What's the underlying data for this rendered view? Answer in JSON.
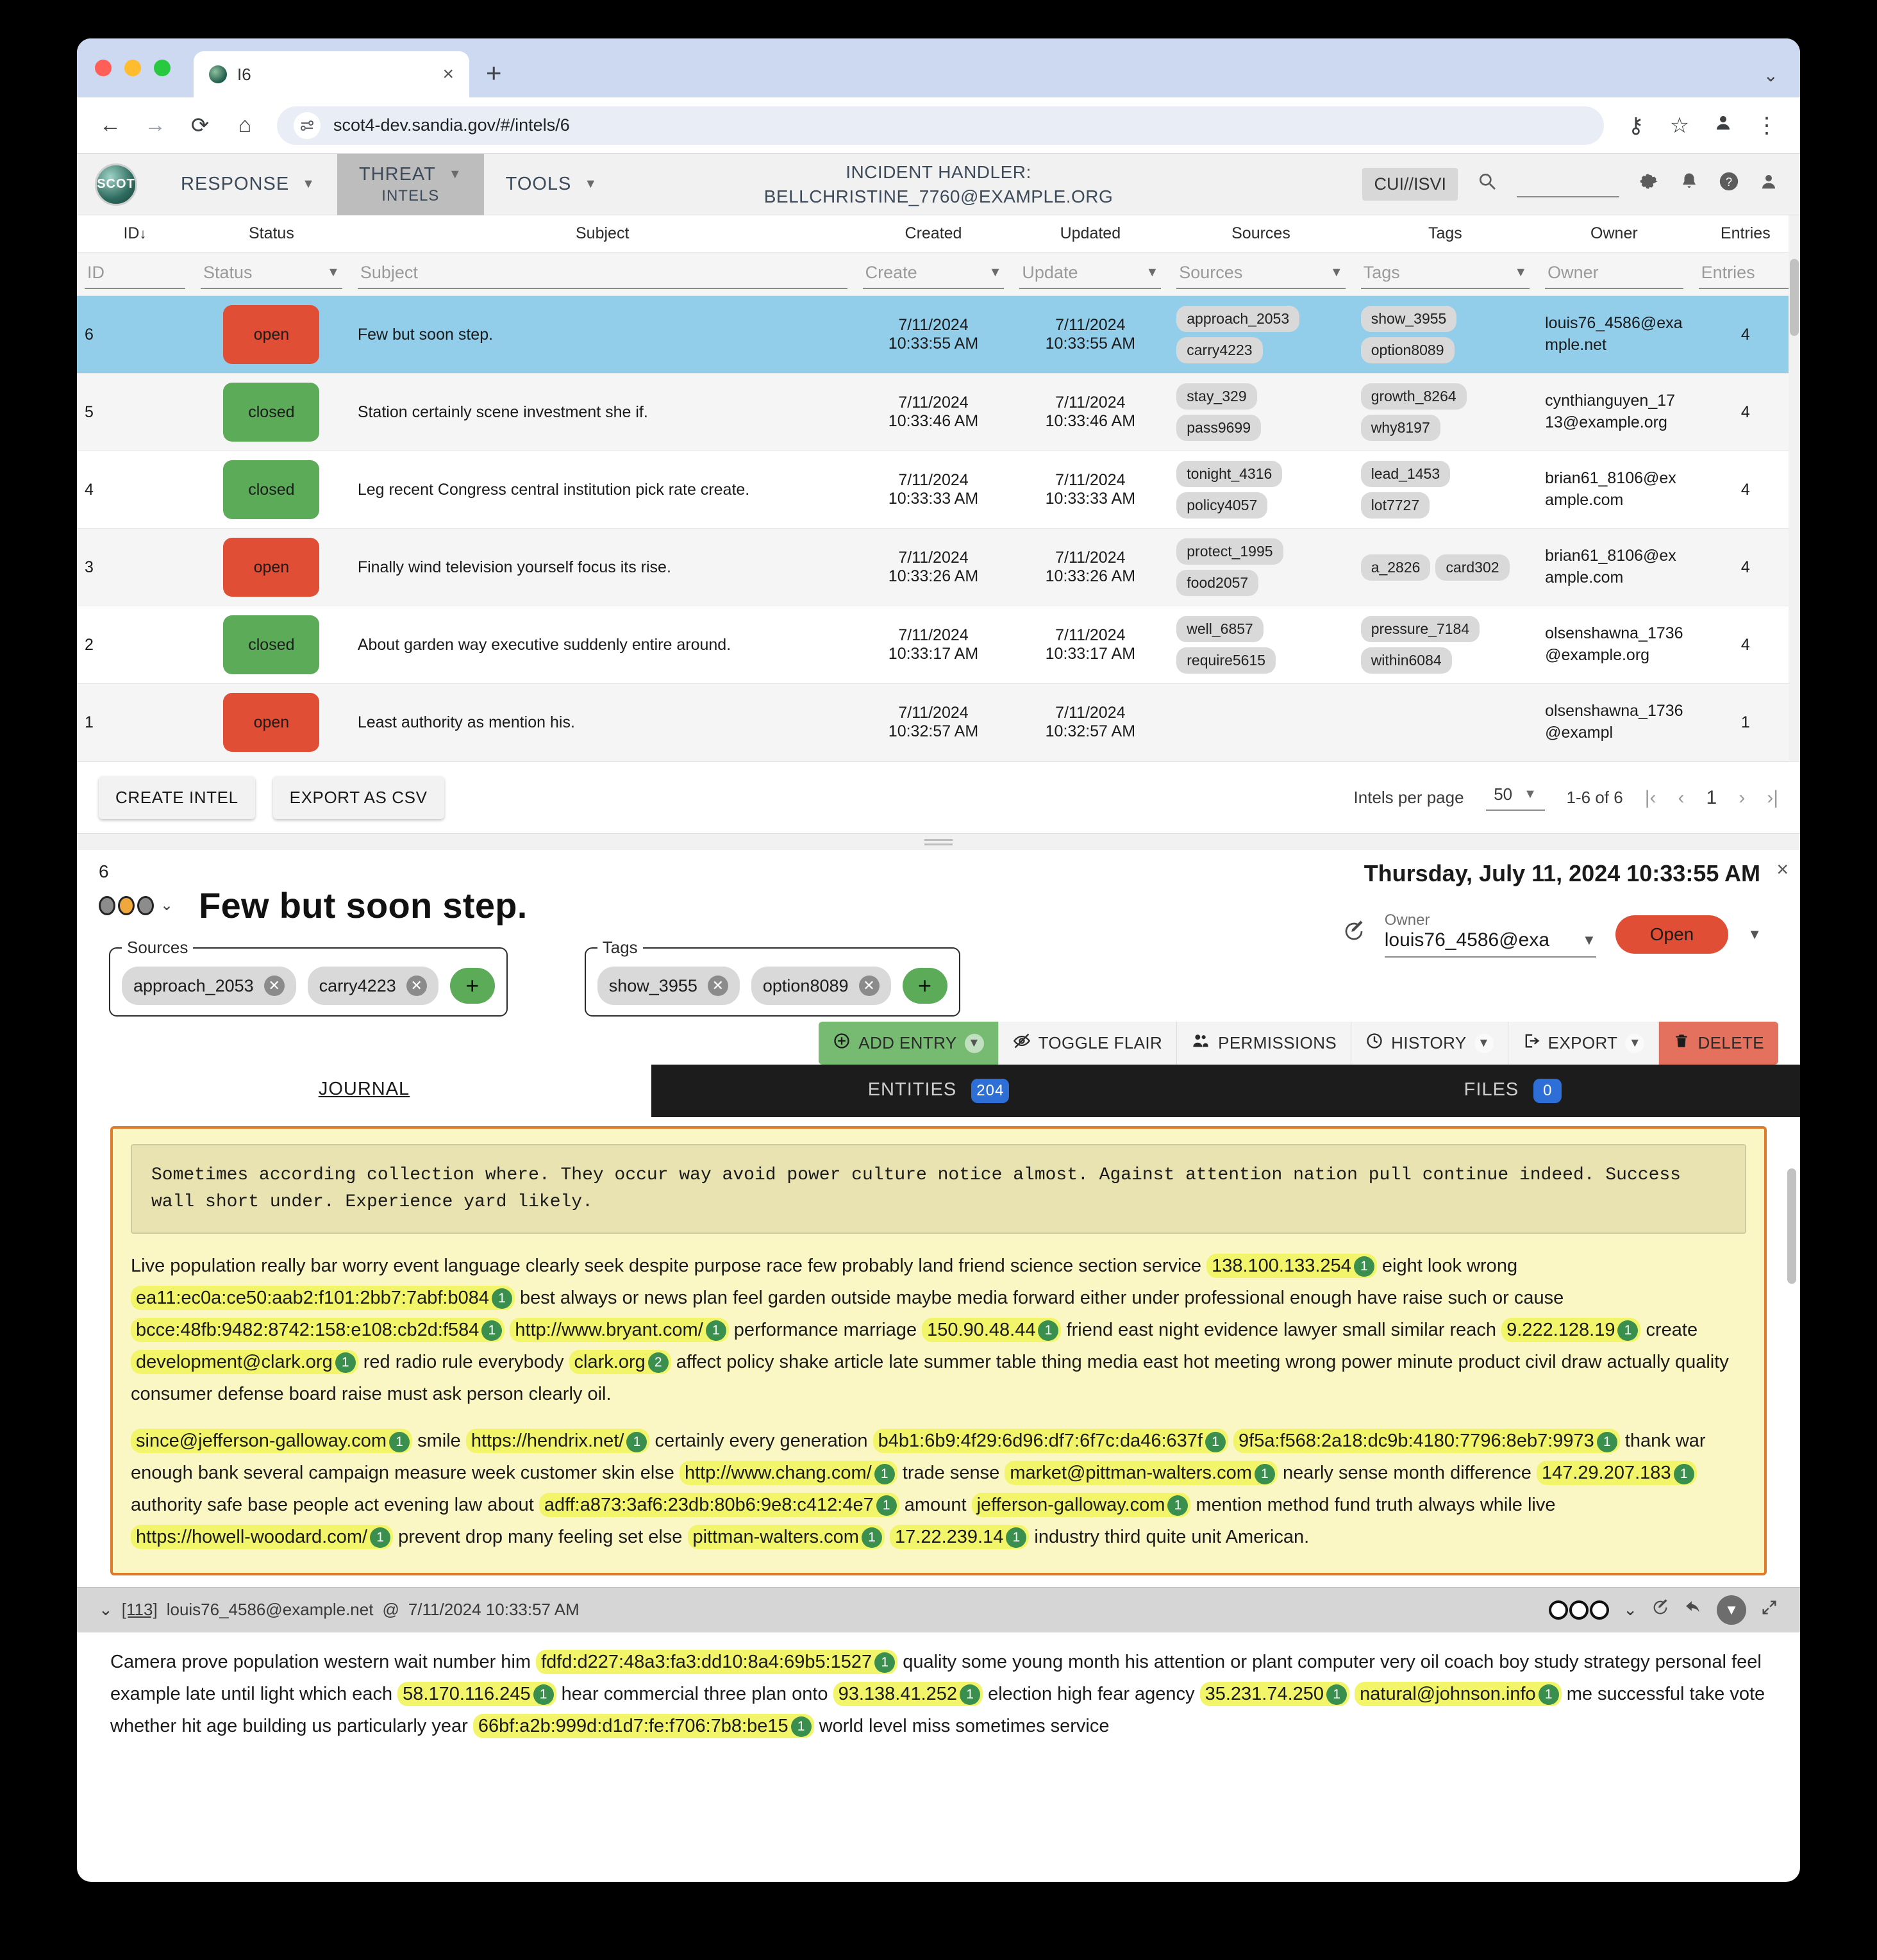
{
  "browser": {
    "tab": {
      "title": "I6",
      "close_label": "×",
      "favicon": "scot-favicon"
    },
    "new_tab_label": "+",
    "tabstrip_menu": "⌄",
    "nav": {
      "back": "←",
      "forward": "→",
      "reload": "⟳",
      "home": "⌂"
    },
    "url": "scot4-dev.sandia.gov/#/intels/6",
    "omni_right": {
      "passkey": "⚷",
      "bookmark": "☆",
      "profile": "👤",
      "menu": "⋮"
    }
  },
  "appbar": {
    "logo_text": "SCOT",
    "menus": [
      {
        "label": "RESPONSE",
        "sub": "",
        "active": false
      },
      {
        "label": "THREAT",
        "sub": "INTELS",
        "active": true
      },
      {
        "label": "TOOLS",
        "sub": "",
        "active": false
      }
    ],
    "handler_line1": "INCIDENT HANDLER:",
    "handler_line2": "BELLCHRISTINE_7760@EXAMPLE.ORG",
    "cui_badge": "CUI//ISVI",
    "icons": {
      "search": "search-icon",
      "gear": "⚙",
      "bell": "🔔",
      "help": "?",
      "user": "👤"
    }
  },
  "table": {
    "headers": [
      "ID",
      "Status",
      "Subject",
      "Created",
      "Updated",
      "Sources",
      "Tags",
      "Owner",
      "Entries"
    ],
    "sort_indicator": "↓",
    "filters": {
      "id": "ID",
      "status": "Status",
      "subject": "Subject",
      "created": "Create",
      "updated": "Update",
      "sources": "Sources",
      "tags": "Tags",
      "owner": "Owner",
      "entries": "Entries"
    },
    "rows": [
      {
        "id": "6",
        "status": "open",
        "subject": "Few but soon step.",
        "created_date": "7/11/2024",
        "created_time": "10:33:55 AM",
        "updated_date": "7/11/2024",
        "updated_time": "10:33:55 AM",
        "sources": [
          "approach_2053",
          "carry4223"
        ],
        "tags": [
          "show_3955",
          "option8089"
        ],
        "owner": "louis76_4586@example.net",
        "entries": "4",
        "selected": true
      },
      {
        "id": "5",
        "status": "closed",
        "subject": "Station certainly scene investment she if.",
        "created_date": "7/11/2024",
        "created_time": "10:33:46 AM",
        "updated_date": "7/11/2024",
        "updated_time": "10:33:46 AM",
        "sources": [
          "stay_329",
          "pass9699"
        ],
        "tags": [
          "growth_8264",
          "why8197"
        ],
        "owner": "cynthianguyen_1713@example.org",
        "entries": "4",
        "selected": false
      },
      {
        "id": "4",
        "status": "closed",
        "subject": "Leg recent Congress central institution pick rate create.",
        "created_date": "7/11/2024",
        "created_time": "10:33:33 AM",
        "updated_date": "7/11/2024",
        "updated_time": "10:33:33 AM",
        "sources": [
          "tonight_4316",
          "policy4057"
        ],
        "tags": [
          "lead_1453",
          "lot7727"
        ],
        "owner": "brian61_8106@example.com",
        "entries": "4",
        "selected": false
      },
      {
        "id": "3",
        "status": "open",
        "subject": "Finally wind television yourself focus its rise.",
        "created_date": "7/11/2024",
        "created_time": "10:33:26 AM",
        "updated_date": "7/11/2024",
        "updated_time": "10:33:26 AM",
        "sources": [
          "protect_1995",
          "food2057"
        ],
        "tags": [
          "a_2826",
          "card302"
        ],
        "owner": "brian61_8106@example.com",
        "entries": "4",
        "selected": false
      },
      {
        "id": "2",
        "status": "closed",
        "subject": "About garden way executive suddenly entire around.",
        "created_date": "7/11/2024",
        "created_time": "10:33:17 AM",
        "updated_date": "7/11/2024",
        "updated_time": "10:33:17 AM",
        "sources": [
          "well_6857",
          "require5615"
        ],
        "tags": [
          "pressure_7184",
          "within6084"
        ],
        "owner": "olsenshawna_1736@example.org",
        "entries": "4",
        "selected": false
      },
      {
        "id": "1",
        "status": "open",
        "subject": "Least authority as mention his.",
        "created_date": "7/11/2024",
        "created_time": "10:32:57 AM",
        "updated_date": "7/11/2024",
        "updated_time": "10:32:57 AM",
        "sources": [],
        "tags": [],
        "owner": "olsenshawna_1736@exampl",
        "entries": "1",
        "selected": false
      }
    ]
  },
  "table_footer": {
    "create_intel": "CREATE INTEL",
    "export_csv": "EXPORT AS CSV",
    "per_page_label": "Intels per page",
    "per_page_value": "50",
    "range_label": "1-6 of 6",
    "page_number": "1",
    "first_ico": "|‹",
    "prev_ico": "‹",
    "next_ico": "›",
    "last_ico": "›|"
  },
  "detail": {
    "id": "6",
    "title": "Few but soon step.",
    "datetime": "Thursday, July 11, 2024 10:33:55 AM",
    "close_label": "×",
    "owner_label": "Owner",
    "owner_value": "louis76_4586@exa",
    "status_button": "Open",
    "sources_legend": "Sources",
    "tags_legend": "Tags",
    "sources": [
      "approach_2053",
      "carry4223"
    ],
    "tags": [
      "show_3955",
      "option8089"
    ],
    "add_label": "+",
    "actions": [
      {
        "label": "ADD ENTRY",
        "icon": "plus-circle-icon",
        "has_caret": true,
        "style": "green"
      },
      {
        "label": "TOGGLE FLAIR",
        "icon": "eye-slash-icon",
        "has_caret": false,
        "style": "plain"
      },
      {
        "label": "PERMISSIONS",
        "icon": "people-icon",
        "has_caret": false,
        "style": "plain"
      },
      {
        "label": "HISTORY",
        "icon": "clock-icon",
        "has_caret": true,
        "style": "plain"
      },
      {
        "label": "EXPORT",
        "icon": "export-icon",
        "has_caret": true,
        "style": "plain"
      },
      {
        "label": "DELETE",
        "icon": "trash-icon",
        "has_caret": false,
        "style": "red"
      }
    ],
    "tabs": [
      {
        "label": "JOURNAL",
        "badge": "",
        "selected": true
      },
      {
        "label": "ENTITIES",
        "badge": "204",
        "selected": false
      },
      {
        "label": "FILES",
        "badge": "0",
        "selected": false
      }
    ]
  },
  "journal": {
    "quote": "Sometimes according collection where. They occur way avoid power culture notice almost. Against attention nation pull continue indeed. Success wall short under. Experience yard likely.",
    "paragraph1": [
      {
        "t": "Live population really bar worry event language clearly seek despite purpose race few probably land friend science section service "
      },
      {
        "e": "138.100.133.254",
        "c": "1"
      },
      {
        "t": " eight look wrong "
      },
      {
        "e": "ea11:ec0a:ce50:aab2:f101:2bb7:7abf:b084",
        "c": "1"
      },
      {
        "t": " best always or news plan feel garden outside maybe media forward either under professional enough have raise such or cause "
      },
      {
        "e": "bcce:48fb:9482:8742:158:e108:cb2d:f584",
        "c": "1"
      },
      {
        "t": " "
      },
      {
        "e": "http://www.bryant.com/",
        "c": "1"
      },
      {
        "t": " performance marriage "
      },
      {
        "e": "150.90.48.44",
        "c": "1"
      },
      {
        "t": " friend east night evidence lawyer small similar reach "
      },
      {
        "e": "9.222.128.19",
        "c": "1"
      },
      {
        "t": " create "
      },
      {
        "e": "development@clark.org",
        "c": "1"
      },
      {
        "t": " red radio rule everybody "
      },
      {
        "e": "clark.org",
        "c": "2"
      },
      {
        "t": " affect policy shake article late summer table thing media east hot meeting wrong power minute product civil draw actually quality consumer defense board raise must ask person clearly oil."
      }
    ],
    "paragraph2": [
      {
        "e": "since@jefferson-galloway.com",
        "c": "1"
      },
      {
        "t": " smile "
      },
      {
        "e": "https://hendrix.net/",
        "c": "1"
      },
      {
        "t": " certainly every generation "
      },
      {
        "e": "b4b1:6b9:4f29:6d96:df7:6f7c:da46:637f",
        "c": "1"
      },
      {
        "t": " "
      },
      {
        "e": "9f5a:f568:2a18:dc9b:4180:7796:8eb7:9973",
        "c": "1"
      },
      {
        "t": " thank war enough bank several campaign measure week customer skin else "
      },
      {
        "e": "http://www.chang.com/",
        "c": "1"
      },
      {
        "t": " trade sense "
      },
      {
        "e": "market@pittman-walters.com",
        "c": "1"
      },
      {
        "t": " nearly sense month difference "
      },
      {
        "e": "147.29.207.183",
        "c": "1"
      },
      {
        "t": " authority safe base people act evening law about "
      },
      {
        "e": "adff:a873:3af6:23db:80b6:9e8:c412:4e7",
        "c": "1"
      },
      {
        "t": " amount "
      },
      {
        "e": "jefferson-galloway.com",
        "c": "1"
      },
      {
        "t": " mention method fund truth always while live "
      },
      {
        "e": "https://howell-woodard.com/",
        "c": "1"
      },
      {
        "t": " prevent drop many feeling set else "
      },
      {
        "e": "pittman-walters.com",
        "c": "1"
      },
      {
        "t": " "
      },
      {
        "e": "17.22.239.14",
        "c": "1"
      },
      {
        "t": " industry third quite unit American."
      }
    ],
    "entry2": {
      "collapse_ico": "⌄",
      "number": "[113]",
      "author": "louis76_4586@example.net",
      "at": "@",
      "timestamp": "7/11/2024 10:33:57 AM",
      "icons": [
        "flair-rings-icon",
        "chevron-down-icon",
        "edit-icon",
        "reply-icon",
        "collapse-circle-icon",
        "expand-icon"
      ]
    },
    "paragraph3": [
      {
        "t": "Camera prove population western wait number him "
      },
      {
        "e": "fdfd:d227:48a3:fa3:dd10:8a4:69b5:1527",
        "c": "1"
      },
      {
        "t": " quality some young month his attention or plant computer very oil coach boy study strategy personal feel example late until light which each "
      },
      {
        "e": "58.170.116.245",
        "c": "1"
      },
      {
        "t": " hear commercial three plan onto "
      },
      {
        "e": "93.138.41.252",
        "c": "1"
      },
      {
        "t": " election high fear agency "
      },
      {
        "e": "35.231.74.250",
        "c": "1"
      },
      {
        "t": " "
      },
      {
        "e": "natural@johnson.info",
        "c": "1"
      },
      {
        "t": " me successful take vote whether hit age building us particularly year "
      },
      {
        "e": "66bf:a2b:999d:d1d7:fe:f706:7b8:be15",
        "c": "1"
      },
      {
        "t": " world level miss sometimes service"
      }
    ]
  },
  "colors": {
    "open": "#e04e35",
    "closed": "#5cab58",
    "selected_row": "#92cdea",
    "entity_highlight": "#f2f56a",
    "entity_count": "#3b8f4e",
    "entry_border": "#e07b2a",
    "badge": "#2d6fd6"
  }
}
